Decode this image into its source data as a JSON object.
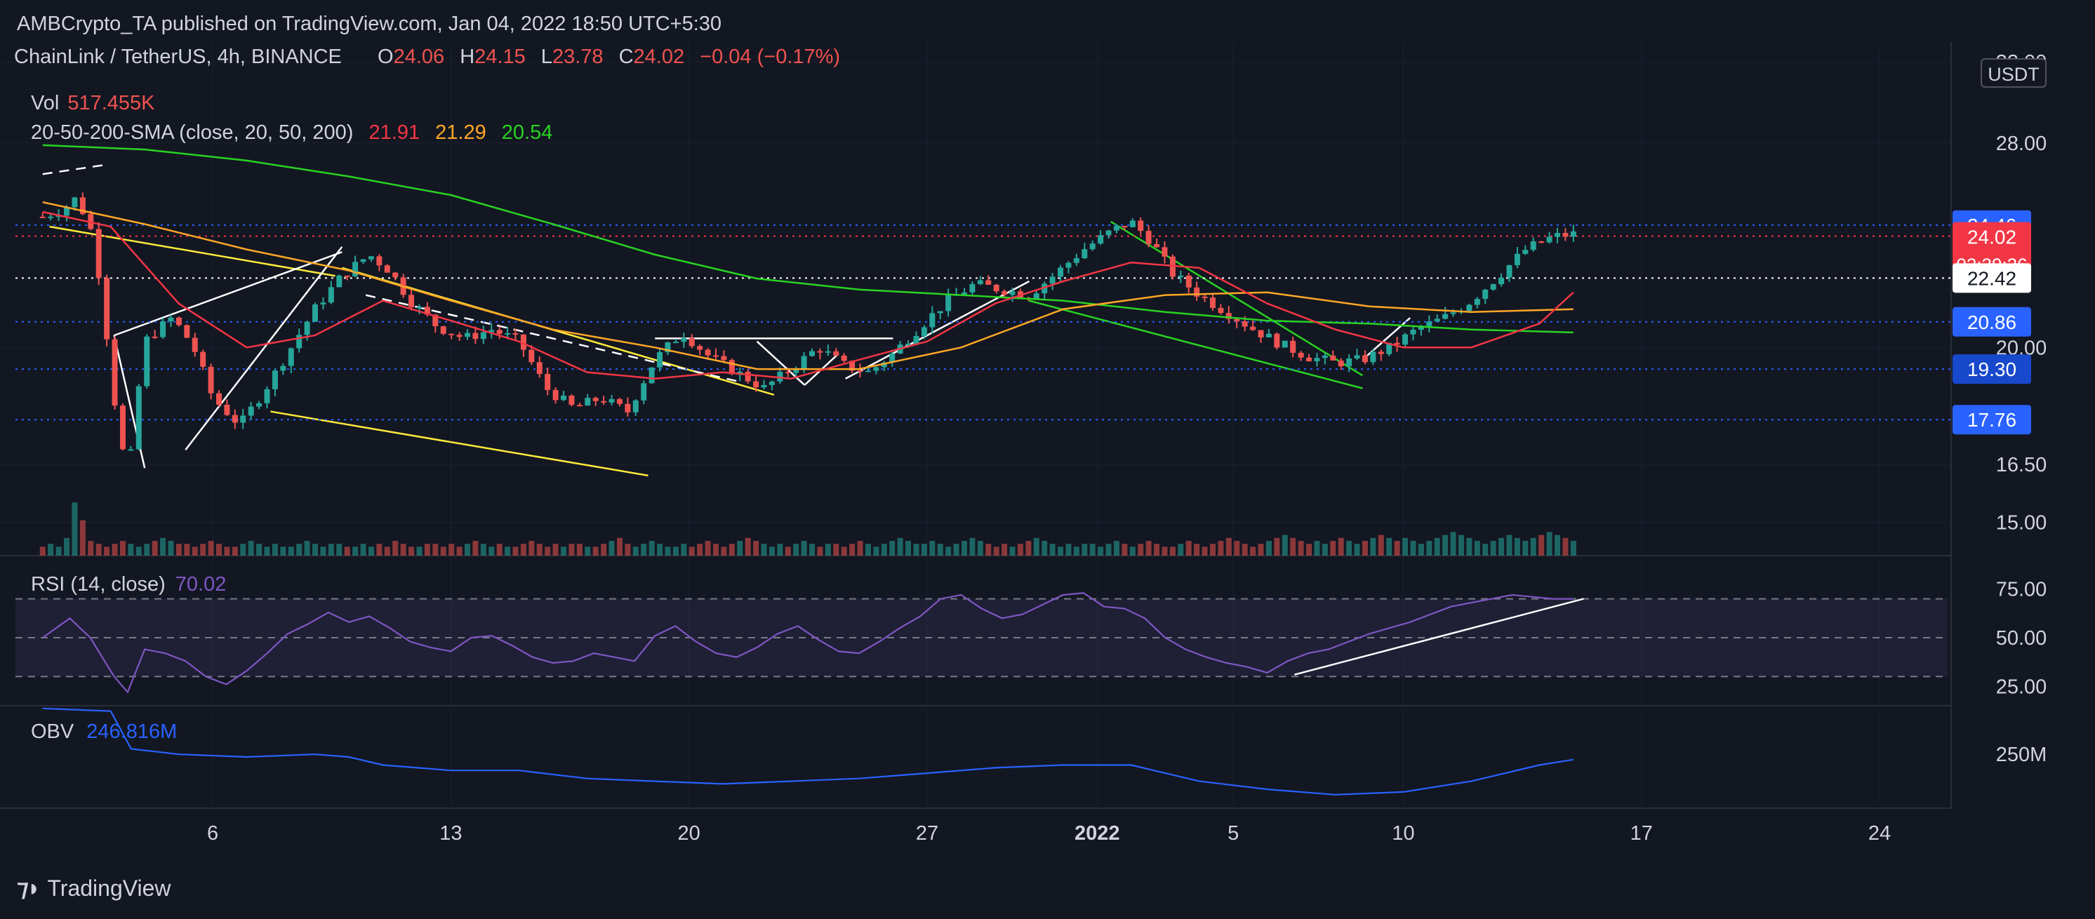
{
  "header": {
    "publisher": "AMBCrypto_TA published on TradingView.com, Jan 04, 2022 18:50 UTC+5:30"
  },
  "footer": {
    "brand": "TradingView"
  },
  "legend": {
    "symbol": "ChainLink / TetherUS, 4h, BINANCE",
    "ohlc": {
      "o_label": "O",
      "o": "24.06",
      "h_label": "H",
      "h": "24.15",
      "l_label": "L",
      "l": "23.78",
      "c_label": "C",
      "c": "24.02",
      "change": "−0.04 (−0.17%)"
    },
    "vol_label": "Vol",
    "vol_value": "517.455K",
    "sma_label": "20-50-200-SMA (close, 20, 50, 200)",
    "sma_values": [
      "21.91",
      "21.29",
      "20.54"
    ],
    "rsi_label": "RSI (14, close)",
    "rsi_value": "70.02",
    "obv_label": "OBV",
    "obv_value": "246.816M"
  },
  "colors": {
    "background": "#131722",
    "bull": "#26a69a",
    "bear": "#ef5350",
    "sma20": "#f23645",
    "sma50": "#ffa726",
    "sma200": "#29d322",
    "rsi": "#7e57c2",
    "obv": "#2962ff",
    "grid": "#2a2e39",
    "text": "#d1d4dc",
    "level_blue": "#2962ff",
    "level_dark_blue": "#1848cc"
  },
  "chart_data": {
    "type": "candlestick",
    "currency_tag": "USDT",
    "x_ticks": [
      "6",
      "13",
      "20",
      "27",
      "2022",
      "5",
      "10",
      "17",
      "24"
    ],
    "x_tick_dates": [
      5,
      12,
      19,
      26,
      31,
      35,
      40,
      47,
      54
    ],
    "x_axis_unit": "days since 2021-12-01",
    "price_ticks": [
      "32.00",
      "28.00",
      "20.00",
      "16.50",
      "15.00"
    ],
    "price_levels": [
      32,
      28,
      20,
      16.5,
      15
    ],
    "y_scale": "log",
    "ylim": [
      14.2,
      32.6
    ],
    "price_tags": [
      {
        "label": "24.46",
        "value": 24.46,
        "bg": "#2962ff",
        "fg": "#ffffff"
      },
      {
        "label": "24.02",
        "sub": "02:39:26",
        "value": 24.02,
        "bg": "#f23645",
        "fg": "#ffffff"
      },
      {
        "label": "22.42",
        "value": 22.42,
        "bg": "#ffffff",
        "fg": "#131722"
      },
      {
        "label": "20.86",
        "value": 20.86,
        "bg": "#2962ff",
        "fg": "#ffffff"
      },
      {
        "label": "19.30",
        "value": 19.3,
        "bg": "#1848cc",
        "fg": "#ffffff"
      },
      {
        "label": "17.76",
        "value": 17.76,
        "bg": "#2962ff",
        "fg": "#ffffff"
      }
    ],
    "hlines": [
      {
        "value": 24.46,
        "style": "dotted",
        "color": "#2962ff"
      },
      {
        "value": 24.02,
        "style": "dotted",
        "color": "#f23645"
      },
      {
        "value": 22.42,
        "style": "dotted",
        "color": "#ffffff"
      },
      {
        "value": 20.86,
        "style": "dotted",
        "color": "#2962ff"
      },
      {
        "value": 19.3,
        "style": "dotted",
        "color": "#2962ff"
      },
      {
        "value": 17.76,
        "style": "dotted",
        "color": "#2962ff"
      }
    ],
    "price_path": [
      [
        0.0,
        24.8
      ],
      [
        0.6,
        25.1
      ],
      [
        1.0,
        25.6
      ],
      [
        1.5,
        24.0
      ],
      [
        2.1,
        18.4
      ],
      [
        2.5,
        16.0
      ],
      [
        3.0,
        20.2
      ],
      [
        3.8,
        21.0
      ],
      [
        4.4,
        20.1
      ],
      [
        5.0,
        18.4
      ],
      [
        5.8,
        17.6
      ],
      [
        6.5,
        18.6
      ],
      [
        7.2,
        19.8
      ],
      [
        8.0,
        21.3
      ],
      [
        8.8,
        22.5
      ],
      [
        9.6,
        23.3
      ],
      [
        10.2,
        22.7
      ],
      [
        10.8,
        21.6
      ],
      [
        11.6,
        20.7
      ],
      [
        12.4,
        20.3
      ],
      [
        13.2,
        20.6
      ],
      [
        14.0,
        20.2
      ],
      [
        14.8,
        18.7
      ],
      [
        15.6,
        18.1
      ],
      [
        16.4,
        18.4
      ],
      [
        17.2,
        18.0
      ],
      [
        18.0,
        19.6
      ],
      [
        18.8,
        20.5
      ],
      [
        19.6,
        19.7
      ],
      [
        20.4,
        19.2
      ],
      [
        21.2,
        18.7
      ],
      [
        22.0,
        19.3
      ],
      [
        22.8,
        20.0
      ],
      [
        23.6,
        19.4
      ],
      [
        24.3,
        19.2
      ],
      [
        25.0,
        19.8
      ],
      [
        25.8,
        20.7
      ],
      [
        26.6,
        21.6
      ],
      [
        27.4,
        22.2
      ],
      [
        28.2,
        22.0
      ],
      [
        29.0,
        21.8
      ],
      [
        29.8,
        22.6
      ],
      [
        30.6,
        23.5
      ],
      [
        31.4,
        24.2
      ],
      [
        32.0,
        24.6
      ],
      [
        32.6,
        23.8
      ],
      [
        33.2,
        22.6
      ],
      [
        34.0,
        21.8
      ],
      [
        34.8,
        21.2
      ],
      [
        35.6,
        20.6
      ],
      [
        36.4,
        20.1
      ],
      [
        37.2,
        19.7
      ],
      [
        38.0,
        19.5
      ],
      [
        38.8,
        19.6
      ],
      [
        39.6,
        20.0
      ],
      [
        40.4,
        20.6
      ],
      [
        41.2,
        21.0
      ],
      [
        42.0,
        21.6
      ],
      [
        42.8,
        22.5
      ],
      [
        43.6,
        23.5
      ],
      [
        44.4,
        24.0
      ],
      [
        45.0,
        24.1
      ]
    ],
    "volume": [
      3,
      4,
      3,
      6,
      18,
      12,
      5,
      4,
      3,
      4,
      5,
      4,
      3,
      4,
      5,
      6,
      5,
      4,
      4,
      3,
      4,
      5,
      4,
      3,
      3,
      4,
      5,
      4,
      3,
      4,
      3,
      3,
      4,
      5,
      4,
      3,
      4,
      4,
      3,
      3,
      4,
      3,
      4,
      3,
      5,
      4,
      3,
      3,
      4,
      4,
      3,
      4,
      3,
      4,
      5,
      4,
      3,
      4,
      3,
      3,
      4,
      5,
      4,
      3,
      4,
      3,
      4,
      4,
      3,
      3,
      4,
      5,
      6,
      4,
      3,
      4,
      5,
      4,
      3,
      3,
      4,
      3,
      4,
      5,
      4,
      3,
      4,
      5,
      6,
      5,
      4,
      3,
      4,
      3,
      4,
      5,
      4,
      3,
      4,
      4,
      3,
      4,
      5,
      4,
      3,
      4,
      5,
      6,
      5,
      4,
      4,
      5,
      4,
      3,
      4,
      5,
      6,
      5,
      4,
      3,
      4,
      3,
      4,
      5,
      6,
      5,
      4,
      3,
      4,
      3,
      4,
      4,
      3,
      4,
      5,
      4,
      3,
      4,
      5,
      4,
      3,
      3,
      4,
      5,
      4,
      3,
      4,
      5,
      6,
      5,
      4,
      3,
      4,
      5,
      6,
      7,
      6,
      5,
      4,
      5,
      4,
      5,
      6,
      5,
      4,
      5,
      6,
      7,
      6,
      5,
      6,
      5,
      4,
      5,
      6,
      7,
      8,
      7,
      6,
      5,
      4,
      5,
      6,
      7,
      6,
      5,
      6,
      7,
      8,
      7,
      6,
      5
    ],
    "sma200_path": [
      [
        0.0,
        27.9
      ],
      [
        3.0,
        27.7
      ],
      [
        6.0,
        27.2
      ],
      [
        9.0,
        26.5
      ],
      [
        12.0,
        25.7
      ],
      [
        15.0,
        24.5
      ],
      [
        18.0,
        23.3
      ],
      [
        21.0,
        22.4
      ],
      [
        24.0,
        22.0
      ],
      [
        27.0,
        21.8
      ],
      [
        30.0,
        21.6
      ],
      [
        33.0,
        21.2
      ],
      [
        36.0,
        20.9
      ],
      [
        39.0,
        20.8
      ],
      [
        42.0,
        20.6
      ],
      [
        45.0,
        20.5
      ]
    ],
    "sma50_path": [
      [
        0.0,
        25.4
      ],
      [
        3.0,
        24.5
      ],
      [
        6.0,
        23.5
      ],
      [
        9.0,
        22.7
      ],
      [
        12.0,
        21.6
      ],
      [
        15.0,
        20.6
      ],
      [
        18.0,
        20.0
      ],
      [
        21.0,
        19.3
      ],
      [
        24.0,
        19.3
      ],
      [
        27.0,
        20.0
      ],
      [
        30.0,
        21.3
      ],
      [
        33.0,
        21.8
      ],
      [
        36.0,
        21.9
      ],
      [
        39.0,
        21.4
      ],
      [
        42.0,
        21.2
      ],
      [
        45.0,
        21.3
      ]
    ],
    "sma20_path": [
      [
        0.0,
        25.0
      ],
      [
        2.0,
        24.4
      ],
      [
        4.0,
        21.5
      ],
      [
        6.0,
        20.0
      ],
      [
        8.0,
        20.4
      ],
      [
        10.0,
        21.6
      ],
      [
        12.0,
        20.9
      ],
      [
        14.0,
        20.2
      ],
      [
        16.0,
        19.2
      ],
      [
        18.0,
        19.0
      ],
      [
        20.0,
        19.2
      ],
      [
        22.0,
        19.0
      ],
      [
        24.0,
        19.6
      ],
      [
        26.0,
        20.2
      ],
      [
        28.0,
        21.5
      ],
      [
        30.0,
        22.3
      ],
      [
        32.0,
        23.0
      ],
      [
        34.0,
        22.8
      ],
      [
        36.0,
        21.5
      ],
      [
        38.0,
        20.6
      ],
      [
        40.0,
        20.0
      ],
      [
        42.0,
        20.0
      ],
      [
        44.0,
        20.8
      ],
      [
        45.0,
        21.9
      ]
    ],
    "rsi": {
      "ticks": [
        "75.00",
        "50.00",
        "25.00"
      ],
      "levels": [
        75,
        50,
        25
      ],
      "ylim": [
        15,
        85
      ],
      "band": [
        30,
        70
      ],
      "path": [
        [
          0.0,
          50
        ],
        [
          0.8,
          60
        ],
        [
          1.4,
          50
        ],
        [
          2.1,
          30
        ],
        [
          2.5,
          22
        ],
        [
          3.0,
          44
        ],
        [
          3.6,
          42
        ],
        [
          4.2,
          38
        ],
        [
          4.8,
          30
        ],
        [
          5.4,
          26
        ],
        [
          6.0,
          33
        ],
        [
          6.6,
          42
        ],
        [
          7.2,
          52
        ],
        [
          7.8,
          57
        ],
        [
          8.4,
          63
        ],
        [
          9.0,
          58
        ],
        [
          9.6,
          61
        ],
        [
          10.2,
          55
        ],
        [
          10.8,
          48
        ],
        [
          11.4,
          45
        ],
        [
          12.0,
          43
        ],
        [
          12.6,
          50
        ],
        [
          13.2,
          51
        ],
        [
          13.8,
          46
        ],
        [
          14.4,
          40
        ],
        [
          15.0,
          37
        ],
        [
          15.6,
          38
        ],
        [
          16.2,
          42
        ],
        [
          16.8,
          40
        ],
        [
          17.4,
          38
        ],
        [
          18.0,
          51
        ],
        [
          18.6,
          56
        ],
        [
          19.2,
          48
        ],
        [
          19.8,
          42
        ],
        [
          20.4,
          40
        ],
        [
          21.0,
          45
        ],
        [
          21.6,
          52
        ],
        [
          22.2,
          56
        ],
        [
          22.8,
          49
        ],
        [
          23.4,
          43
        ],
        [
          24.0,
          42
        ],
        [
          24.6,
          48
        ],
        [
          25.2,
          55
        ],
        [
          25.8,
          61
        ],
        [
          26.4,
          70
        ],
        [
          27.0,
          72
        ],
        [
          27.6,
          65
        ],
        [
          28.2,
          60
        ],
        [
          28.8,
          62
        ],
        [
          29.4,
          67
        ],
        [
          30.0,
          72
        ],
        [
          30.6,
          73
        ],
        [
          31.2,
          66
        ],
        [
          31.8,
          65
        ],
        [
          32.4,
          60
        ],
        [
          33.0,
          50
        ],
        [
          33.6,
          44
        ],
        [
          34.2,
          40
        ],
        [
          34.8,
          37
        ],
        [
          35.4,
          35
        ],
        [
          36.0,
          32
        ],
        [
          36.6,
          38
        ],
        [
          37.2,
          42
        ],
        [
          37.8,
          44
        ],
        [
          38.4,
          48
        ],
        [
          39.0,
          52
        ],
        [
          39.6,
          55
        ],
        [
          40.2,
          58
        ],
        [
          40.8,
          62
        ],
        [
          41.4,
          66
        ],
        [
          42.0,
          68
        ],
        [
          42.6,
          70
        ],
        [
          43.2,
          72
        ],
        [
          43.8,
          71
        ],
        [
          44.4,
          70
        ],
        [
          45.0,
          70
        ]
      ]
    },
    "obv": {
      "tick": "250M",
      "tick_value": 250,
      "ylim": [
        150,
        340
      ],
      "path": [
        [
          0.0,
          335
        ],
        [
          2.0,
          330
        ],
        [
          2.6,
          260
        ],
        [
          4.0,
          250
        ],
        [
          6.0,
          245
        ],
        [
          8.0,
          250
        ],
        [
          9.0,
          245
        ],
        [
          10.0,
          230
        ],
        [
          12.0,
          220
        ],
        [
          14.0,
          220
        ],
        [
          16.0,
          205
        ],
        [
          18.0,
          200
        ],
        [
          20.0,
          195
        ],
        [
          22.0,
          200
        ],
        [
          24.0,
          205
        ],
        [
          26.0,
          215
        ],
        [
          28.0,
          225
        ],
        [
          30.0,
          230
        ],
        [
          32.0,
          230
        ],
        [
          33.0,
          215
        ],
        [
          34.0,
          200
        ],
        [
          36.0,
          185
        ],
        [
          38.0,
          175
        ],
        [
          40.0,
          180
        ],
        [
          42.0,
          200
        ],
        [
          44.0,
          230
        ],
        [
          45.0,
          240
        ]
      ]
    }
  }
}
